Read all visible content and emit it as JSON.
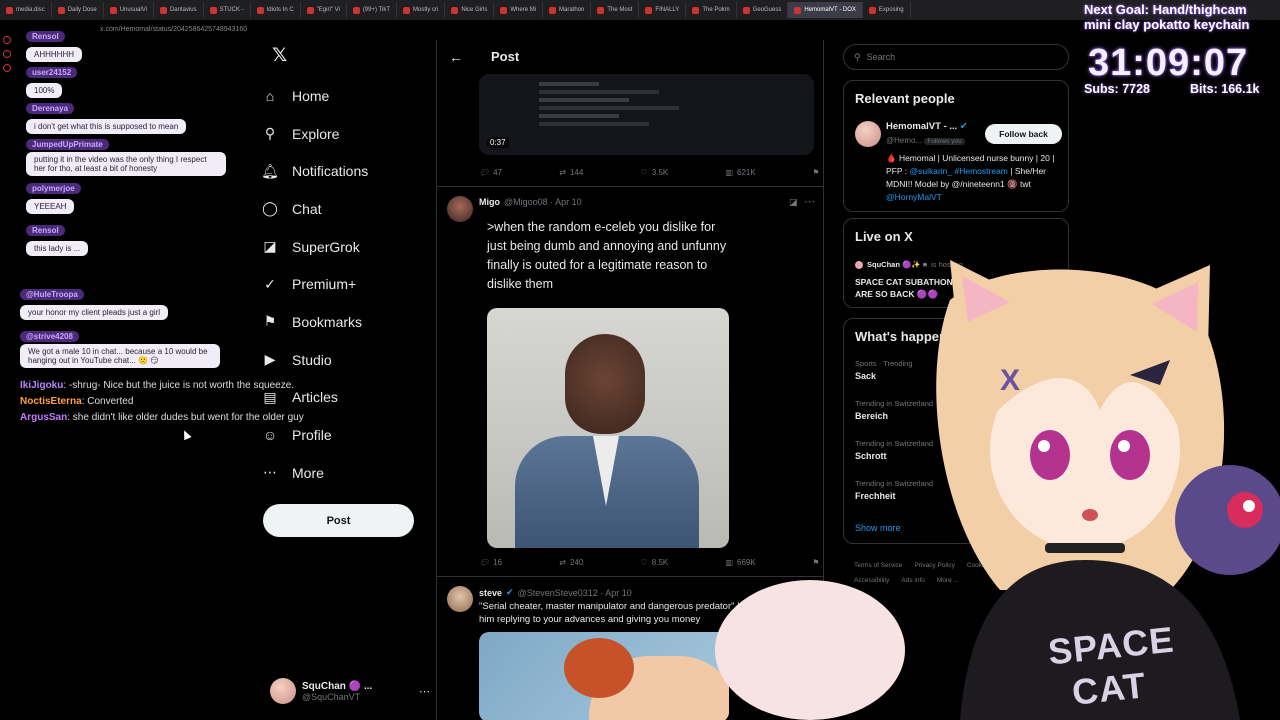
{
  "browser": {
    "tabs": [
      "media.disc",
      "Daily Dose",
      "UnusualVi",
      "Dantavius",
      "STUCK -",
      "Idiots In C",
      "\"Egirl\" Vi",
      "(99+) TikT",
      "Mostly cri",
      "Nice Girls",
      "Where Mi",
      "Marathon",
      "The Most",
      "FINALLY",
      "The Pokm",
      "GeoGuess",
      "HemomalVT - DOX",
      "Exposing"
    ],
    "active_tab": 16,
    "url": "x.com/Hemomal/status/2042586425748943160"
  },
  "chat": {
    "bubbles": [
      {
        "user": "Rensol",
        "text": "AHHHHHH"
      },
      {
        "user": "user24152",
        "text": "100%"
      },
      {
        "user": "Derenaya",
        "text": "i don't get what this is supposed to mean"
      },
      {
        "user": "JumpedUpPrimate",
        "text": "putting it in the video was the only thing I respect her for tho, at least a bit of honesty"
      },
      {
        "user": "polymerjoe",
        "text": "YEEEAH"
      },
      {
        "user": "Rensol",
        "text": "this lady is ..."
      },
      {
        "user": "@HuleTroopa",
        "text": "your honor my client pleads just a girl"
      },
      {
        "user": "@strive4208",
        "text": "We got a male 10 in chat... because a 10 would be hanging out in YouTube chat... 🙁 😏"
      }
    ],
    "lines": [
      {
        "user": "IkiJigoku",
        "color": "#b784ff",
        "text": ": -shrug- Nice but the juice is not worth the squeeze."
      },
      {
        "user": "NoctisEterna",
        "color": "#ff9f43",
        "text": ": Converted"
      },
      {
        "user": "ArgusSan",
        "color": "#c27bff",
        "text": ": she didn't like older dudes but went for the older guy"
      }
    ]
  },
  "nav": {
    "items": [
      {
        "label": "Home",
        "icon": "home-icon",
        "glyph": "⌂"
      },
      {
        "label": "Explore",
        "icon": "search-icon",
        "glyph": "⚲"
      },
      {
        "label": "Notifications",
        "icon": "bell-icon",
        "glyph": "🔔︎"
      },
      {
        "label": "Chat",
        "icon": "chat-icon",
        "glyph": "◯"
      },
      {
        "label": "SuperGrok",
        "icon": "grok-icon",
        "glyph": "◪"
      },
      {
        "label": "Premium+",
        "icon": "premium-icon",
        "glyph": "✓"
      },
      {
        "label": "Bookmarks",
        "icon": "bookmark-icon",
        "glyph": "⚑"
      },
      {
        "label": "Studio",
        "icon": "studio-icon",
        "glyph": "▶"
      },
      {
        "label": "Articles",
        "icon": "articles-icon",
        "glyph": "▤"
      },
      {
        "label": "Profile",
        "icon": "profile-icon",
        "glyph": "☺"
      },
      {
        "label": "More",
        "icon": "more-circle-icon",
        "glyph": "⋯"
      }
    ],
    "post_label": "Post",
    "account_name": "SquChan 🟣 ...",
    "account_handle": "@SquChanVT"
  },
  "main": {
    "header_title": "Post",
    "top_video": {
      "duration": "0:37",
      "replies": "47",
      "reposts": "144",
      "likes": "3.5K",
      "views": "621K"
    },
    "tweets": [
      {
        "name": "Migo",
        "handle": "@Migoo08 · Apr 10",
        "text": ">when the random e-celeb you dislike for just being dumb and annoying and unfunny finally is outed for a legitimate reason to dislike them",
        "replies": "16",
        "reposts": "240",
        "likes": "8.5K",
        "views": "669K"
      },
      {
        "name": "steve",
        "handle": "@StevenSteve0312 · Apr 10",
        "text": "\"Serial cheater, master manipulator and dangerous predator\" It's just him replying to your advances and giving you money"
      }
    ]
  },
  "right": {
    "search_placeholder": "Search",
    "relevant_title": "Relevant people",
    "person": {
      "name": "HemomalVT - ...",
      "handle": "@Hemo...",
      "follows_you": "Follows you",
      "follow_label": "Follow back",
      "bio_a": "🩸 Hemomal | Unlicensed nurse bunny | 20 | PFP : ",
      "bio_link1": "@suikarin_",
      "bio_link2": "#Hemostream",
      "bio_b": " | She/Her MDNI!! Model by @/nineteenn1 🔞 twt ",
      "bio_link3": "@HornyMalVT"
    },
    "live_title": "Live on X",
    "live": {
      "host": "SquChan 🟣✨ ≡",
      "status": "is hosting",
      "title": "SPACE CAT SUBATHON DAY 6 - WE ARE SO BACK 🟣🟣"
    },
    "happening_title": "What's happening",
    "trends": [
      {
        "sub": "Sports · Trending",
        "name": "Sack"
      },
      {
        "sub": "Trending in Switzerland",
        "name": "Bereich"
      },
      {
        "sub": "Trending in Switzerland",
        "name": "Schrott"
      },
      {
        "sub": "Trending in Switzerland",
        "name": "Frechheit"
      }
    ],
    "show_more": "Show more",
    "footer": [
      "Terms of Service",
      "Privacy Policy",
      "Cookie Policy",
      "Accessibility",
      "Ads info",
      "More ..."
    ]
  },
  "overlay": {
    "goal_line1": "Next Goal: Hand/thighcam",
    "goal_line2": "mini clay pokatto keychain",
    "timer": "31:09:07",
    "subs": "Subs: 7728",
    "bits": "Bits: 166.1k",
    "shirt_text_1": "SPACE",
    "shirt_text_2": "CAT"
  }
}
